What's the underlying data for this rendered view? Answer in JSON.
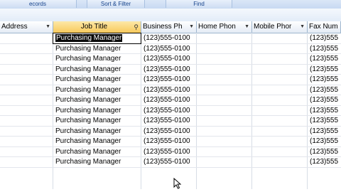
{
  "ribbon": {
    "groups": [
      {
        "label": "ecords"
      },
      {
        "label": "Sort & Filter"
      },
      {
        "label": "Find"
      }
    ]
  },
  "columns": [
    {
      "label": "Address"
    },
    {
      "label": "Job Title"
    },
    {
      "label": "Business Ph"
    },
    {
      "label": "Home Phon"
    },
    {
      "label": "Mobile Phor"
    },
    {
      "label": "Fax Num"
    }
  ],
  "rows": [
    {
      "job_title": "Purchasing Manager",
      "business_phone": "(123)555-0100",
      "fax": "(123)555"
    },
    {
      "job_title": "Purchasing Manager",
      "business_phone": "(123)555-0100",
      "fax": "(123)555"
    },
    {
      "job_title": "Purchasing Manager",
      "business_phone": "(123)555-0100",
      "fax": "(123)555"
    },
    {
      "job_title": "Purchasing Manager",
      "business_phone": "(123)555-0100",
      "fax": "(123)555"
    },
    {
      "job_title": "Purchasing Manager",
      "business_phone": "(123)555-0100",
      "fax": "(123)555"
    },
    {
      "job_title": "Purchasing Manager",
      "business_phone": "(123)555-0100",
      "fax": "(123)555"
    },
    {
      "job_title": "Purchasing Manager",
      "business_phone": "(123)555-0100",
      "fax": "(123)555"
    },
    {
      "job_title": "Purchasing Manager",
      "business_phone": "(123)555-0100",
      "fax": "(123)555"
    },
    {
      "job_title": "Purchasing Manager",
      "business_phone": "(123)555-0100",
      "fax": "(123)555"
    },
    {
      "job_title": "Purchasing Manager",
      "business_phone": "(123)555-0100",
      "fax": "(123)555"
    },
    {
      "job_title": "Purchasing Manager",
      "business_phone": "(123)555-0100",
      "fax": "(123)555"
    },
    {
      "job_title": "Purchasing Manager",
      "business_phone": "(123)555-0100",
      "fax": "(123)555"
    },
    {
      "job_title": "Purchasing Manager",
      "business_phone": "(123)555-0100",
      "fax": "(123)555"
    }
  ],
  "selected_row": 0,
  "active_column": "Job Title",
  "icons": {
    "filter": "filter-icon",
    "dropdown": "chevron-down-icon",
    "cursor": "mouse-pointer-icon"
  }
}
